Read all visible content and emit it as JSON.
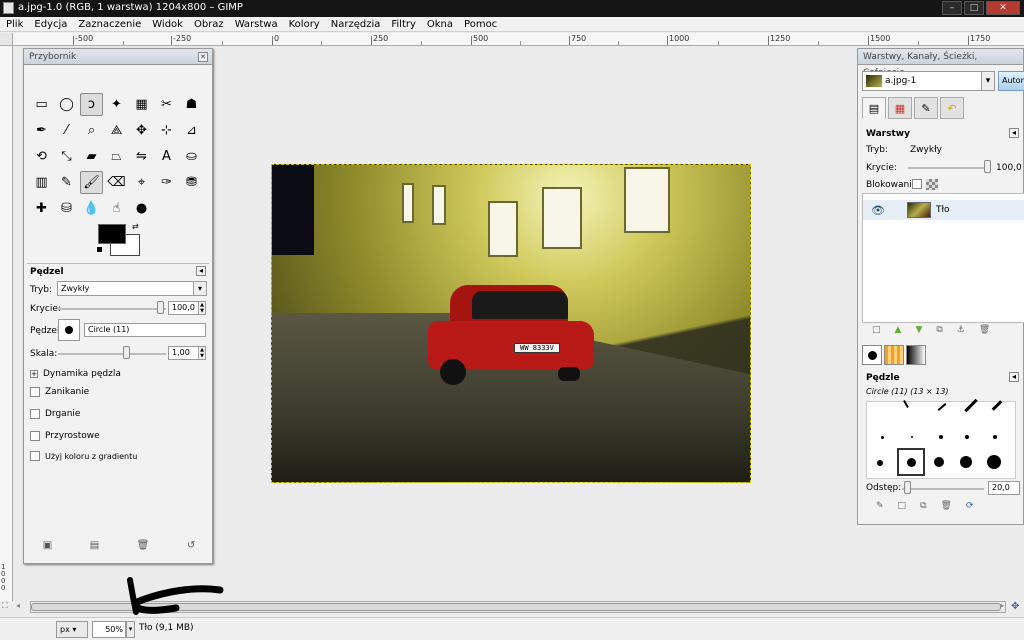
{
  "window": {
    "title": "a.jpg-1.0 (RGB, 1 warstwa) 1204x800 – GIMP",
    "controls": {
      "minimize": "–",
      "maximize": "□",
      "close": "✕"
    }
  },
  "menu": [
    "Plik",
    "Edycja",
    "Zaznaczenie",
    "Widok",
    "Obraz",
    "Warstwa",
    "Kolory",
    "Narzędzia",
    "Filtry",
    "Okna",
    "Pomoc"
  ],
  "ruler": {
    "top_labels": [
      "-500",
      "-250",
      "0",
      "250",
      "500",
      "750",
      "1000",
      "1250",
      "1500",
      "1750"
    ],
    "left_labels": [
      "1000"
    ]
  },
  "toolbox": {
    "title": "Przybornik",
    "tools": [
      {
        "name": "rect-select-icon",
        "glyph": "▭"
      },
      {
        "name": "ellipse-select-icon",
        "glyph": "◯"
      },
      {
        "name": "free-select-icon",
        "glyph": "ↄ"
      },
      {
        "name": "fuzzy-select-icon",
        "glyph": "✦"
      },
      {
        "name": "color-select-icon",
        "glyph": "▦"
      },
      {
        "name": "scissors-icon",
        "glyph": "✂"
      },
      {
        "name": "foreground-select-icon",
        "glyph": "☗"
      },
      {
        "name": "paths-icon",
        "glyph": "✒"
      },
      {
        "name": "color-picker-icon",
        "glyph": "⁄"
      },
      {
        "name": "zoom-icon",
        "glyph": "⌕"
      },
      {
        "name": "measure-icon",
        "glyph": "⟁"
      },
      {
        "name": "move-icon",
        "glyph": "✥"
      },
      {
        "name": "align-icon",
        "glyph": "⊹"
      },
      {
        "name": "crop-icon",
        "glyph": "⊿"
      },
      {
        "name": "rotate-icon",
        "glyph": "⟲"
      },
      {
        "name": "scale-icon",
        "glyph": "⤡"
      },
      {
        "name": "shear-icon",
        "glyph": "▰"
      },
      {
        "name": "perspective-icon",
        "glyph": "⏢"
      },
      {
        "name": "flip-icon",
        "glyph": "⇋"
      },
      {
        "name": "text-icon",
        "glyph": "A"
      },
      {
        "name": "bucket-fill-icon",
        "glyph": "⛀"
      },
      {
        "name": "blend-icon",
        "glyph": "▥"
      },
      {
        "name": "pencil-icon",
        "glyph": "✎"
      },
      {
        "name": "paintbrush-icon",
        "glyph": "🖌"
      },
      {
        "name": "eraser-icon",
        "glyph": "⌫"
      },
      {
        "name": "airbrush-icon",
        "glyph": "⌖"
      },
      {
        "name": "ink-icon",
        "glyph": "✑"
      },
      {
        "name": "clone-icon",
        "glyph": "⛃"
      },
      {
        "name": "heal-icon",
        "glyph": "✚"
      },
      {
        "name": "perspective-clone-icon",
        "glyph": "⛁"
      },
      {
        "name": "blur-icon",
        "glyph": "💧"
      },
      {
        "name": "smudge-icon",
        "glyph": "☝"
      },
      {
        "name": "dodge-burn-icon",
        "glyph": "●"
      }
    ],
    "options_title": "Pędzel",
    "mode_label": "Tryb:",
    "mode_value": "Zwykły",
    "opacity_label": "Krycie:",
    "opacity_value": "100,0",
    "opacity_fraction": 1.0,
    "brush_label": "Pędzel:",
    "brush_value": "Circle (11)",
    "scale_label": "Skala:",
    "scale_value": "1,00",
    "dynamics": "Dynamika pędzla",
    "checks": [
      "Zanikanie",
      "Drganie",
      "Przyrostowe",
      "Użyj koloru z gradientu"
    ],
    "footer_icons": [
      "save-options-icon",
      "restore-options-icon",
      "delete-options-icon",
      "reset-options-icon"
    ]
  },
  "layers_dock": {
    "title": "Warstwy, Kanały, Ścieżki, Cofnięcie...",
    "image_select": "a.jpg-1",
    "auto_button": "Autom",
    "section": "Warstwy",
    "mode_label": "Tryb:",
    "mode_value": "Zwykły",
    "opacity_label": "Krycie:",
    "opacity_value": "100,0",
    "lock_label": "Blokowanie:",
    "layer_name": "Tło",
    "brushes_title": "Pędzle",
    "brush_info": "Circle (11) (13 × 13)",
    "spacing_label": "Odstęp:",
    "spacing_value": "20,0"
  },
  "canvas": {
    "plate": "WW 8333V"
  },
  "status": {
    "unit": "px",
    "zoom": "50%",
    "text": "Tło (9,1 MB)"
  },
  "colors": {
    "titlebar": "#151515",
    "car": "#b91a18",
    "accent": "#cfc95a"
  }
}
